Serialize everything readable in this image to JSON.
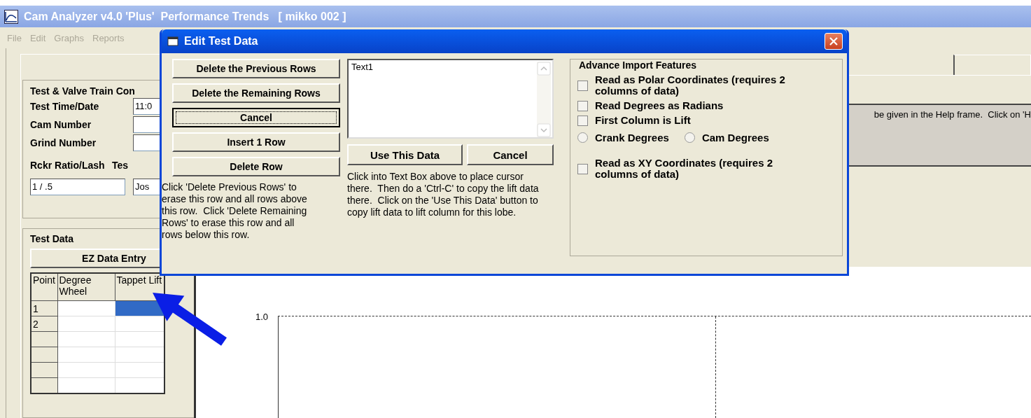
{
  "window": {
    "title": "Cam Analyzer v4.0 'Plus'  Performance Trends   [ mikko 002 ]"
  },
  "menu": [
    {
      "label": "File",
      "disabled": true
    },
    {
      "label": "Edit",
      "disabled": true
    },
    {
      "label": "Graphs",
      "disabled": true
    },
    {
      "label": "Reports",
      "disabled": true
    }
  ],
  "valve_train": {
    "legend": "Test & Valve Train Con",
    "fields": [
      {
        "label": "Test Time/Date",
        "value": "11:0"
      },
      {
        "label": "Cam Number"
      },
      {
        "label": "Grind Number"
      }
    ],
    "rocker": {
      "label": "Rckr Ratio/Lash",
      "value": "1 / .5"
    },
    "tester": {
      "label": "Tes",
      "value": "Jos"
    }
  },
  "test_data": {
    "legend": "Test Data",
    "button": "EZ Data Entry",
    "table": {
      "columns": [
        "Point",
        "Degree Wheel",
        "Tappet Lift"
      ],
      "rows": [
        {
          "point": "1",
          "lift_selected": true
        },
        {
          "point": "2",
          "lift_selected": false
        },
        {
          "lift_selected": false
        },
        {
          "lift_selected": false
        },
        {
          "lift_selected": false
        },
        {
          "lift_selected": false
        }
      ]
    }
  },
  "help_panel": {
    "text": "be given in the Help frame.  Click on 'H"
  },
  "chart": {
    "y_tick_label": "1.0"
  },
  "dialog": {
    "title": "Edit Test Data",
    "row_buttons": [
      {
        "label": "Delete the Previous Rows",
        "focused": false
      },
      {
        "label": "Delete the Remaining Rows",
        "focused": false
      },
      {
        "label": "Cancel",
        "focused": true
      },
      {
        "label": "Insert 1 Row",
        "focused": false
      },
      {
        "label": "Delete Row",
        "focused": false
      }
    ],
    "row_help": "Click 'Delete Previous Rows' to erase this row and all rows above this row.  Click 'Delete Remaining Rows' to erase this row and all rows below this row.",
    "paste_box": {
      "value": "Text1"
    },
    "paste_buttons": [
      {
        "label": "Use This Data"
      },
      {
        "label": "Cancel"
      }
    ],
    "paste_help": "Click into Text Box above to place cursor there.  Then do a 'Ctrl-C' to copy the lift data there.  Click on the 'Use This Data' button to copy lift data to lift column for this lobe.",
    "import": {
      "legend": "Advance Import Features",
      "options": [
        {
          "kind": "checkbox",
          "label": "Read as Polar Coordinates (requires 2 columns of data)",
          "checked": false
        },
        {
          "kind": "checkbox",
          "label": "Read Degrees as Radians",
          "checked": false
        },
        {
          "kind": "checkbox",
          "label": "First Column is Lift",
          "checked": false
        },
        {
          "kind": "radios",
          "options": [
            {
              "label": "Crank Degrees",
              "selected": false
            },
            {
              "label": "Cam Degrees",
              "selected": false
            }
          ]
        },
        {
          "kind": "checkbox",
          "label": "Read as XY Coordinates (requires 2 columns of data)",
          "checked": false
        }
      ]
    }
  }
}
